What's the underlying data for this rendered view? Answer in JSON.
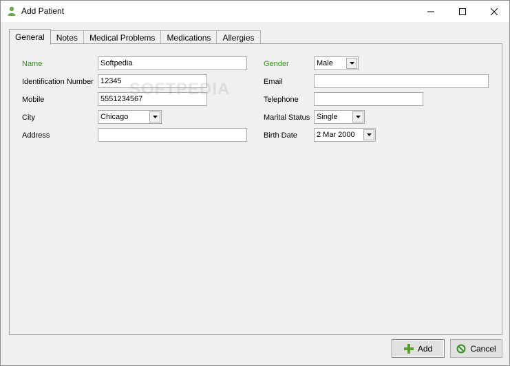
{
  "window": {
    "title": "Add Patient",
    "icon": "person-icon"
  },
  "tabs": [
    {
      "label": "General",
      "active": true
    },
    {
      "label": "Notes",
      "active": false
    },
    {
      "label": "Medical Problems",
      "active": false
    },
    {
      "label": "Medications",
      "active": false
    },
    {
      "label": "Allergies",
      "active": false
    }
  ],
  "form": {
    "name": {
      "label": "Name",
      "value": "Softpedia"
    },
    "identification": {
      "label": "Identification Number",
      "value": "12345"
    },
    "mobile": {
      "label": "Mobile",
      "value": "5551234567"
    },
    "city": {
      "label": "City",
      "value": "Chicago"
    },
    "address": {
      "label": "Address",
      "value": ""
    },
    "gender": {
      "label": "Gender",
      "value": "Male"
    },
    "email": {
      "label": "Email",
      "value": ""
    },
    "telephone": {
      "label": "Telephone",
      "value": ""
    },
    "marital_status": {
      "label": "Marital Status",
      "value": "Single"
    },
    "birth_date": {
      "label": "Birth Date",
      "value": "2 Mar 2000"
    }
  },
  "watermark": "SOFTPEDIA",
  "buttons": {
    "add": {
      "label": "Add",
      "icon": "plus-icon"
    },
    "cancel": {
      "label": "Cancel",
      "icon": "cancel-icon"
    }
  },
  "colors": {
    "required_label": "#3c8c2c",
    "add_icon": "#5a9e2f",
    "cancel_icon": "#3d8a2a"
  }
}
